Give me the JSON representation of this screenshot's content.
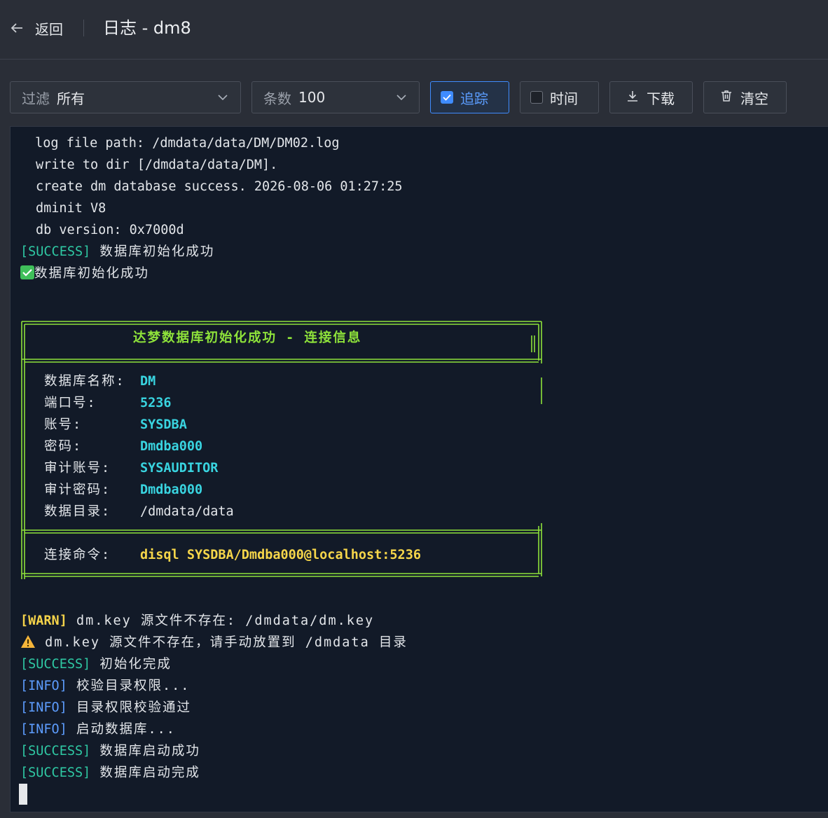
{
  "header": {
    "back_label": "返回",
    "title": "日志 - dm8"
  },
  "toolbar": {
    "filter": {
      "label": "过滤",
      "value": "所有"
    },
    "count": {
      "label": "条数",
      "value": "100"
    },
    "trace_label": "追踪",
    "time_label": "时间",
    "download_label": "下载",
    "clear_label": "清空"
  },
  "log": {
    "l1": " log file path: /dmdata/data/DM/DM02.log",
    "l2": "write to dir [/dmdata/data/DM].",
    "l3": "create dm database success. 2026-08-06 01:27:25",
    "l4": "dminit V8",
    "l5": "db version: 0x7000d",
    "l6_tag": "[SUCCESS]",
    "l6_msg": " 数据库初始化成功",
    "l7_msg": "数据库初始化成功",
    "box_title": "达梦数据库初始化成功 - 连接信息",
    "rows": [
      {
        "key": "数据库名称:",
        "value": "DM"
      },
      {
        "key": "端口号:",
        "value": "5236"
      },
      {
        "key": "账号:",
        "value": "SYSDBA"
      },
      {
        "key": "密码:",
        "value": "Dmdba000"
      },
      {
        "key": "审计账号:",
        "value": "SYSAUDITOR"
      },
      {
        "key": "审计密码:",
        "value": "Dmdba000"
      },
      {
        "key": "数据目录:",
        "value": "/dmdata/data"
      }
    ],
    "cmd_key": "连接命令:",
    "cmd_value": "disql SYSDBA/Dmdba000@localhost:5236",
    "w1_tag": "[WARN]",
    "w1_msg": " dm.key 源文件不存在: /dmdata/dm.key",
    "w2_msg": " dm.key 源文件不存在，请手动放置到 /dmdata 目录",
    "s2_tag": "[SUCCESS]",
    "s2_msg": " 初始化完成",
    "i1_tag": "[INFO]",
    "i1_msg": " 校验目录权限...",
    "i2_tag": "[INFO]",
    "i2_msg": " 目录权限校验通过",
    "i3_tag": "[INFO]",
    "i3_msg": " 启动数据库...",
    "s3_tag": "[SUCCESS]",
    "s3_msg": " 数据库启动成功",
    "s4_tag": "[SUCCESS]",
    "s4_msg": " 数据库启动完成"
  },
  "colors": {
    "success": "#2fc9a4",
    "info": "#5d9dff",
    "warn": "#f5d34a",
    "frame": "#8ee23a",
    "value": "#39d4e0",
    "accent": "#3f8cff"
  },
  "icons": [
    "arrow-left-icon",
    "chevron-down-icon",
    "checkbox-checked-icon",
    "checkbox-empty-icon",
    "download-icon",
    "trash-icon",
    "check-emoji-icon",
    "warning-emoji-icon"
  ]
}
